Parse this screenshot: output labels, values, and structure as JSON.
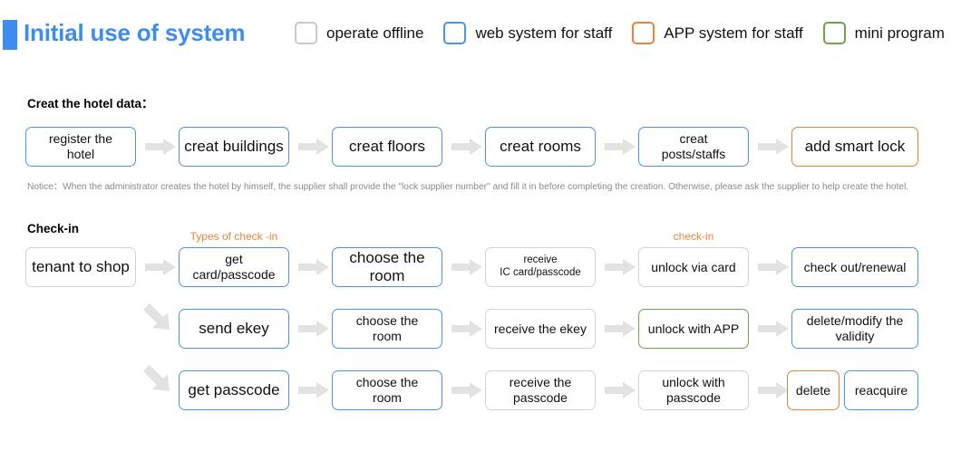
{
  "header": {
    "title": "Initial use of system",
    "accent_color": "#3b8ef0",
    "legend": [
      {
        "label": "operate offline",
        "color": "#c9c9c9",
        "icon": "checkbox-icon"
      },
      {
        "label": "web system for staff",
        "color": "#4a95e8",
        "icon": "checkbox-icon"
      },
      {
        "label": "APP system for staff",
        "color": "#e8833a",
        "icon": "checkbox-icon"
      },
      {
        "label": "mini program",
        "color": "#6aa84f",
        "icon": "checkbox-icon"
      }
    ]
  },
  "sections": {
    "create_hotel": {
      "title": "Creat the hotel data：",
      "nodes": [
        {
          "label": "register the\nhotel",
          "color": "#4a95e8"
        },
        {
          "label": "creat buildings",
          "color": "#4a95e8"
        },
        {
          "label": "creat floors",
          "color": "#4a95e8"
        },
        {
          "label": "creat rooms",
          "color": "#4a95e8"
        },
        {
          "label": "creat\nposts/staffs",
          "color": "#4a95e8"
        },
        {
          "label": "add smart lock",
          "color": "#e8833a"
        }
      ],
      "notice": "Notice：When the administrator creates the hotel by himself, the supplier shall provide the \"lock supplier number\" and fill it in before completing the creation. Otherwise, please ask the supplier to help create the hotel."
    },
    "check_in": {
      "title": "Check-in",
      "sublabels": [
        {
          "text": "Types of check -in",
          "color": "#e8833a"
        },
        {
          "text": "check-in",
          "color": "#e8833a"
        }
      ],
      "start_node": {
        "label": "tenant to shop",
        "color": "#d3d3d3"
      },
      "rows": [
        {
          "nodes": [
            {
              "label": "get\ncard/passcode",
              "color": "#4a95e8"
            },
            {
              "label": "choose the\nroom",
              "color": "#4a95e8"
            },
            {
              "label": "receive\nIC card/passcode",
              "color": "#d3d3d3"
            },
            {
              "label": "unlock via card",
              "color": "#d3d3d3"
            },
            {
              "label": "check out/renewal",
              "color": "#4a95e8"
            }
          ]
        },
        {
          "nodes": [
            {
              "label": "send ekey",
              "color": "#4a95e8"
            },
            {
              "label": "choose the\nroom",
              "color": "#4a95e8"
            },
            {
              "label": "receive the ekey",
              "color": "#d3d3d3"
            },
            {
              "label": "unlock with APP",
              "color": "#6aa84f"
            },
            {
              "label": "delete/modify the\nvalidity",
              "color": "#4a95e8"
            }
          ]
        },
        {
          "nodes": [
            {
              "label": "get passcode",
              "color": "#4a95e8"
            },
            {
              "label": "choose the\nroom",
              "color": "#4a95e8"
            },
            {
              "label": "receive the\npasscode",
              "color": "#d3d3d3"
            },
            {
              "label": "unlock with\npasscode",
              "color": "#d3d3d3"
            },
            {
              "label": "delete",
              "color": "#e8833a"
            },
            {
              "label": "reacquire",
              "color": "#4a95e8"
            }
          ]
        }
      ]
    }
  }
}
